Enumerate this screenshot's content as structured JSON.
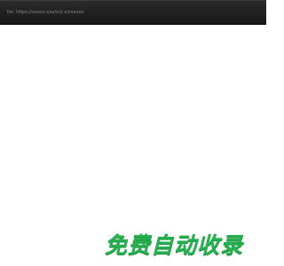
{
  "header": {
    "breadcrumb_text": "for: https://xxxxx.xxx/x/x x/xxxxxx"
  },
  "banner": {
    "text": "免费自动收录"
  },
  "colors": {
    "top_bar": "#1a1a1a",
    "banner_green": "#22b14c",
    "background": "#ffffff"
  }
}
